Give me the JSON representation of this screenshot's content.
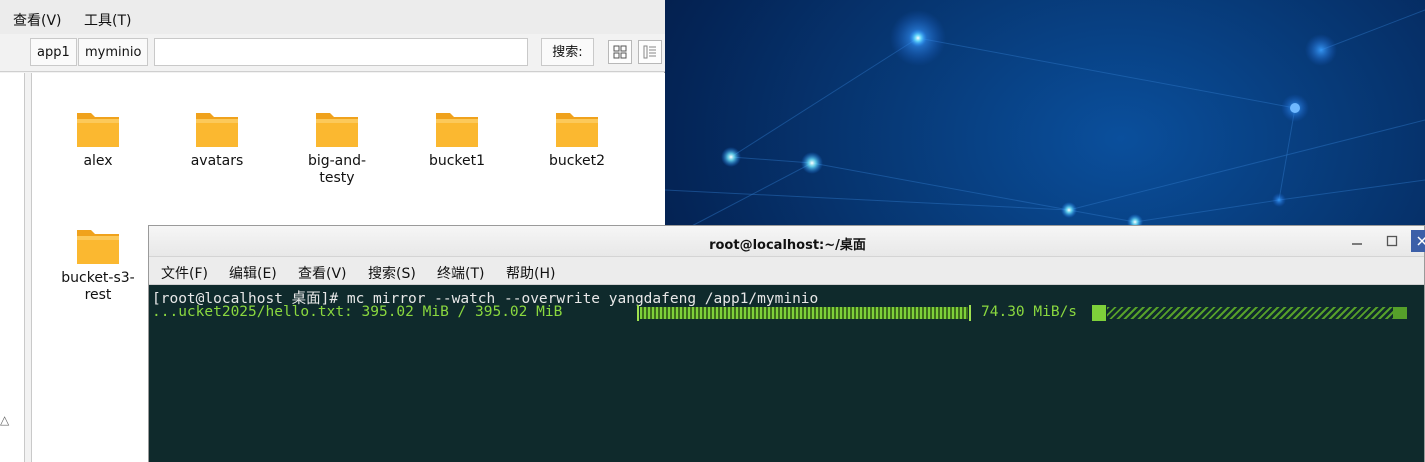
{
  "file_manager": {
    "menu": [
      "查看(V)",
      "工具(T)"
    ],
    "breadcrumbs": [
      "app1",
      "myminio"
    ],
    "search_label": "搜索:",
    "folders": [
      "alex",
      "avatars",
      "big-and-testy",
      "bucket1",
      "bucket2",
      "bucket-s3-rest"
    ]
  },
  "terminal": {
    "title": "root@localhost:~/桌面",
    "menu": [
      "文件(F)",
      "编辑(E)",
      "查看(V)",
      "搜索(S)",
      "终端(T)",
      "帮助(H)"
    ],
    "prompt_line": "[root@localhost 桌面]# mc mirror --watch --overwrite yangdafeng /app1/myminio",
    "progress_label": "...ucket2025/hello.txt: 395.02 MiB / 395.02 MiB",
    "progress_fraction": 1.0,
    "speed": "74.30 MiB/s",
    "text_color": "#8ad83f",
    "background_color": "#0f2a2c"
  },
  "icons": {
    "folder": "folder-icon",
    "grid_view": "grid-view-icon",
    "list_view": "list-view-icon",
    "minimize": "minimize-icon",
    "maximize": "maximize-icon",
    "close": "close-icon"
  }
}
